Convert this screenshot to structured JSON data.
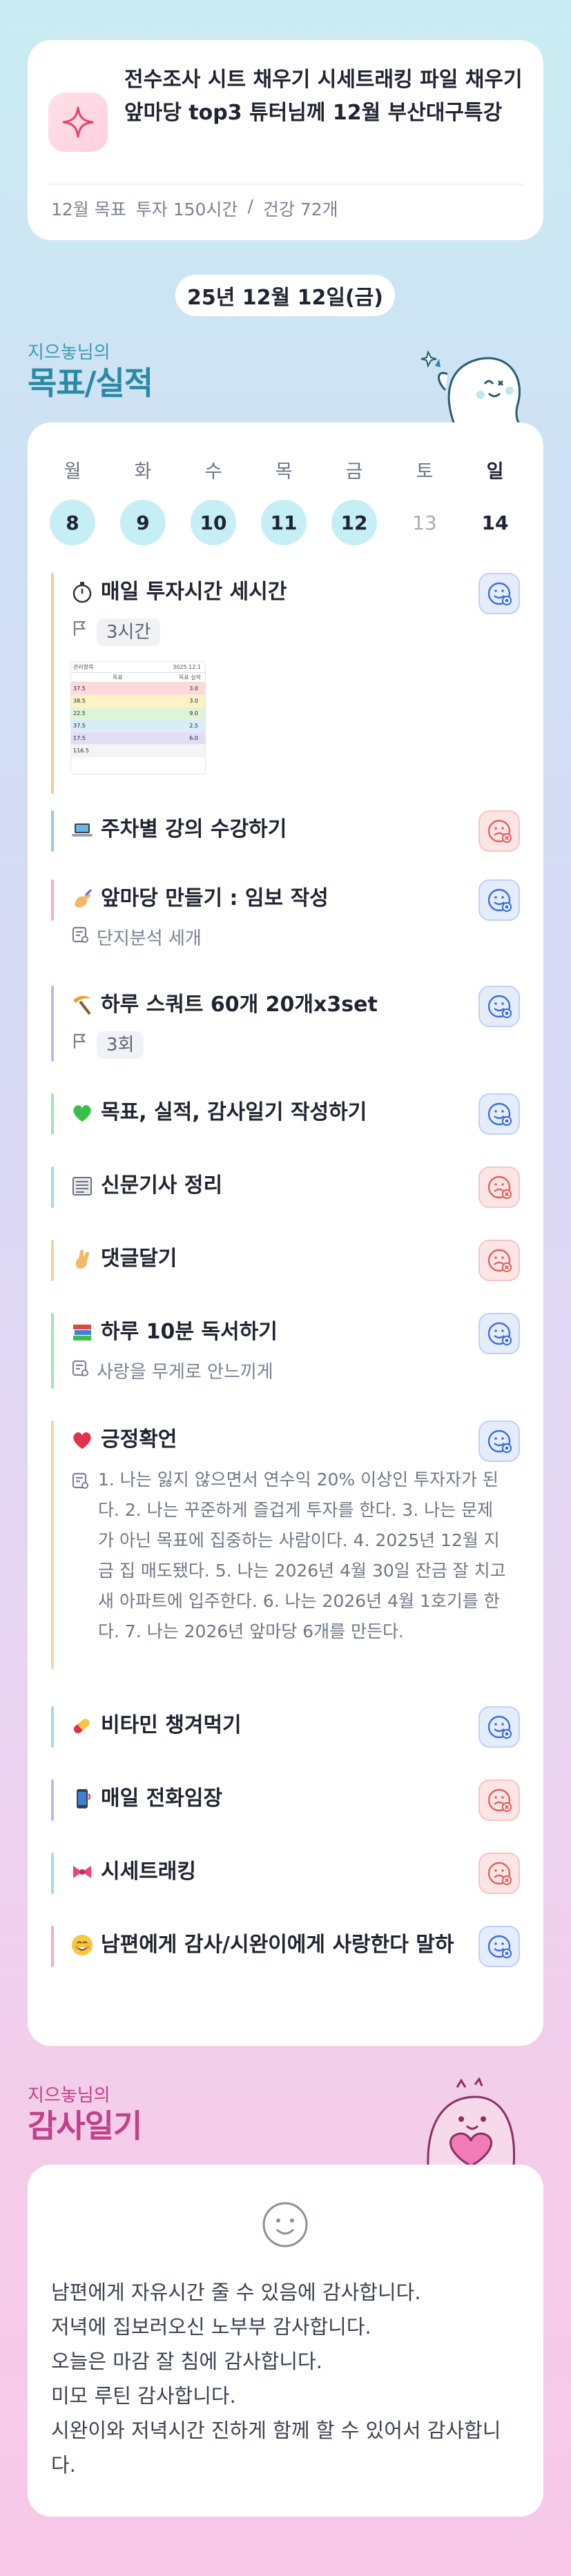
{
  "goal_card": {
    "icon": "sparkle-icon",
    "text": "전수조사 시트 채우기 시세트래킹 파일 채우기 앞마당 top3 튜터님께 12월 부산대구특강",
    "month_label": "12월 목표",
    "investment": "투자 150시간",
    "health": "건강 72개"
  },
  "date_label": "25년 12월 12일(금)",
  "goals_section": {
    "owner": "지으놓님의",
    "title": "목표/실적"
  },
  "week": [
    {
      "name": "월",
      "date": "8",
      "state": "on"
    },
    {
      "name": "화",
      "date": "9",
      "state": "on"
    },
    {
      "name": "수",
      "date": "10",
      "state": "on"
    },
    {
      "name": "목",
      "date": "11",
      "state": "on"
    },
    {
      "name": "금",
      "date": "12",
      "state": "on"
    },
    {
      "name": "토",
      "date": "13",
      "state": "off"
    },
    {
      "name": "일",
      "date": "14",
      "state": "plain"
    }
  ],
  "tasks": [
    {
      "title": "매일 투자시간 세시간",
      "icon": "stopwatch-icon",
      "status": "done",
      "bar": "#f2c9a0",
      "meta_icon": "flag-icon",
      "meta": "3시간",
      "meta_chip": true,
      "has_thumb": true
    },
    {
      "title": "주차별 강의 수강하기",
      "icon": "laptop-icon",
      "status": "miss",
      "bar": "#9fc6f0"
    },
    {
      "title": "앞마당 만들기 : 임보 작성",
      "icon": "writing-hand-icon",
      "status": "done",
      "bar": "#f3b0c0",
      "meta_icon": "note-icon",
      "meta": "단지분석 세개"
    },
    {
      "title": "하루 스쿼트 60개 20개x3set",
      "icon": "pick-icon",
      "status": "done",
      "bar": "#c6b3ef",
      "meta_icon": "flag-icon",
      "meta": "3회",
      "meta_chip": true
    },
    {
      "title": "목표, 실적, 감사일기 작성하기",
      "icon": "green-heart-icon",
      "status": "done",
      "bar": "#a9e0b4"
    },
    {
      "title": "신문기사 정리",
      "icon": "newspaper-icon",
      "status": "miss",
      "bar": "#a6d9ee"
    },
    {
      "title": "댓글달기",
      "icon": "fingers-crossed-icon",
      "status": "miss",
      "bar": "#f5d29a"
    },
    {
      "title": "하루 10분 독서하기",
      "icon": "books-icon",
      "status": "done",
      "bar": "#a9e0b4",
      "meta_icon": "note-icon",
      "meta": "사랑을 무게로 안느끼게"
    },
    {
      "title": "긍정확언",
      "icon": "red-heart-icon",
      "status": "done",
      "bar": "#f6d3a6",
      "meta_icon": "note-icon",
      "note": "1. 나는 잃지 않으면서 연수익 20% 이상인 투자자가 된다. 2. 나는 꾸준하게 즐겁게 투자를 한다. 3. 나는 문제가 아닌 목표에 집중하는 사람이다. 4. 2025년 12월 지금 집 매도됐다. 5. 나는 2026년 4월 30일 잔금 잘 치고 새 아파트에 입주한다. 6. 나는 2026년 4월 1호기를 한다. 7. 나는 2026년 앞마당 6개를 만든다."
    },
    {
      "title": "비타민 챙겨먹기",
      "icon": "pill-icon",
      "status": "done",
      "bar": "#a6d9ee"
    },
    {
      "title": "매일 전화임장",
      "icon": "phone-icon",
      "status": "miss",
      "bar": "#c6b3ef"
    },
    {
      "title": "시세트래킹",
      "icon": "ribbon-icon",
      "status": "miss",
      "bar": "#a6d9ee"
    },
    {
      "title": "남편에게 감사/시완이에게 사랑한다 말하",
      "icon": "smiling-face-icon",
      "status": "done",
      "bar": "#f3b0c0"
    }
  ],
  "thumb": {
    "col1": "관리항목",
    "col2": "목표",
    "col3": "3025.12.1",
    "col4": "목표 실적",
    "rows": [
      [
        "37.5",
        "3.0"
      ],
      [
        "38.5",
        "3.0"
      ],
      [
        "22.5",
        "9.0"
      ],
      [
        "37.5",
        "2.5"
      ],
      [
        "17.5",
        "6.0"
      ],
      [
        "116.5",
        ""
      ]
    ],
    "row_colors": [
      "#ffd9d9",
      "#fff2c2",
      "#dff3d8",
      "#d9ecf7",
      "#e2dcf5",
      "#f4f4f4"
    ]
  },
  "gratitude_section": {
    "owner": "지으놓님의",
    "title": "감사일기"
  },
  "gratitude": {
    "lines": [
      "남편에게 자유시간 줄 수 있음에 감사합니다.",
      "저녁에 집보러오신 노부부 감사합니다.",
      "오늘은 마감 잘 침에 감사합니다.",
      "미모 루틴 감사합니다.",
      "시완이와 저녁시간 진하게 함께 할 수 있어서 감사합니다."
    ]
  },
  "colors": {
    "accent": "#2a8aa6",
    "pink": "#c2408a",
    "done": "#3b6fe0",
    "miss": "#e06363"
  }
}
